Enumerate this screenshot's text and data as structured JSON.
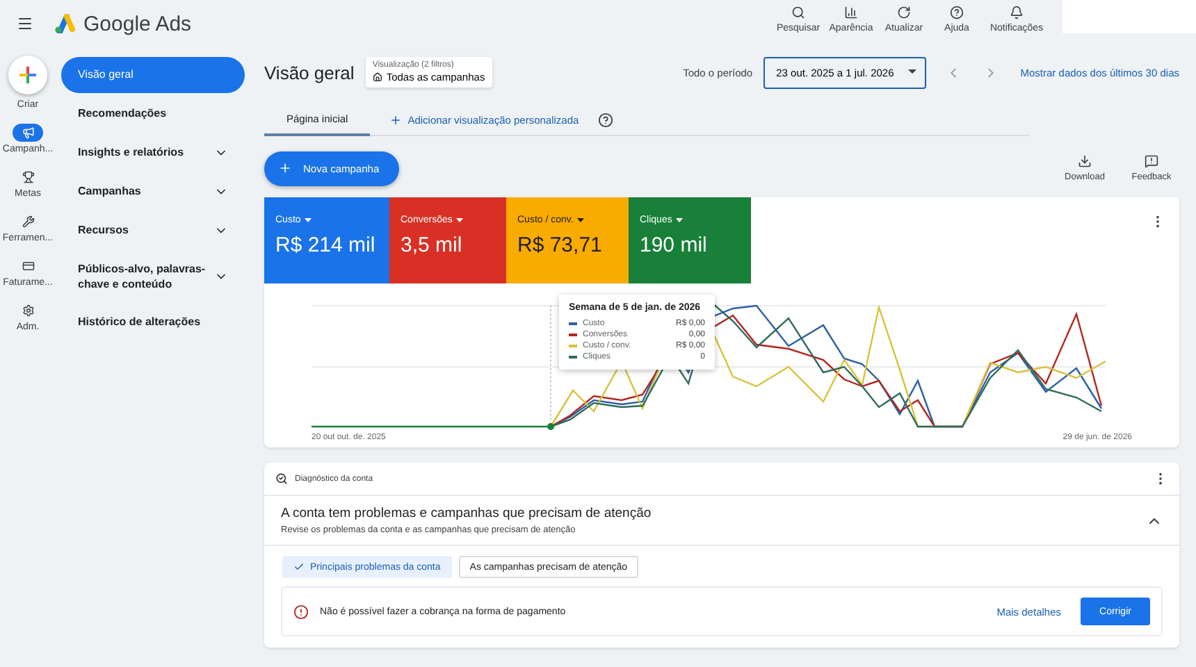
{
  "header": {
    "logo_text": "Google Ads",
    "actions": [
      {
        "kind": "search",
        "label": "Pesquisar"
      },
      {
        "kind": "appearance",
        "label": "Aparência"
      },
      {
        "kind": "refresh",
        "label": "Atualizar"
      },
      {
        "kind": "help",
        "label": "Ajuda"
      },
      {
        "kind": "notifications",
        "label": "Notificações"
      }
    ]
  },
  "rail": {
    "create_label": "Criar",
    "items": [
      {
        "kind": "campaigns",
        "label": "Campanh...",
        "selected": true
      },
      {
        "kind": "goals",
        "label": "Metas",
        "selected": false
      },
      {
        "kind": "tools",
        "label": "Ferramen...",
        "selected": false
      },
      {
        "kind": "billing",
        "label": "Faturame...",
        "selected": false
      },
      {
        "kind": "admin",
        "label": "Adm.",
        "selected": false
      }
    ]
  },
  "nav": {
    "items": [
      {
        "label": "Visão geral",
        "expandable": false,
        "selected": true
      },
      {
        "label": "Recomendações",
        "expandable": false,
        "selected": false
      },
      {
        "label": "Insights e relatórios",
        "expandable": true,
        "selected": false
      },
      {
        "label": "Campanhas",
        "expandable": true,
        "selected": false
      },
      {
        "label": "Recursos",
        "expandable": true,
        "selected": false
      },
      {
        "label": "Públicos-alvo, palavras-chave e conteúdo",
        "expandable": true,
        "selected": false
      },
      {
        "label": "Histórico de alterações",
        "expandable": false,
        "selected": false
      }
    ]
  },
  "page": {
    "title": "Visão geral",
    "view_filter": {
      "caption": "Visualização (2 filtros)",
      "value": "Todas as campanhas"
    },
    "period_label": "Todo o período",
    "date_range": "23 out. 2025 a 1 jul. 2026",
    "last30_link": "Mostrar dados dos últimos 30 dias",
    "tabs": [
      {
        "label": "Página inicial",
        "selected": true
      }
    ],
    "add_view": "Adicionar visualização personalizada",
    "new_campaign": "Nova campanha",
    "tools": [
      {
        "kind": "download",
        "label": "Download"
      },
      {
        "kind": "feedback",
        "label": "Feedback"
      }
    ],
    "metrics": [
      {
        "label": "Custo",
        "value": "R$ 214 mil",
        "color": "#1a73e8"
      },
      {
        "label": "Conversões",
        "value": "3,5 mil",
        "color": "#d93025"
      },
      {
        "label": "Custo / conv.",
        "value": "R$ 73,71",
        "color": "#f9ab00"
      },
      {
        "label": "Cliques",
        "value": "190 mil",
        "color": "#188038"
      }
    ],
    "chart": {
      "x_start": "20 out out. de. 2025",
      "x_end": "29 de jun. de 2026",
      "tooltip": {
        "title": "Semana de 5 de jan. de 2026",
        "rows": [
          {
            "label": "Custo",
            "value": "R$ 0,00",
            "color": "#2b5fa8"
          },
          {
            "label": "Conversões",
            "value": "0,00",
            "color": "#b3261e"
          },
          {
            "label": "Custo / conv.",
            "value": "R$ 0,00",
            "color": "#d8c23c"
          },
          {
            "label": "Cliques",
            "value": "0",
            "color": "#2e6b5b"
          }
        ]
      }
    },
    "diagnostics": {
      "title": "Diagnóstico da conta",
      "heading": "A conta tem problemas e campanhas que precisam de atenção",
      "subheading": "Revise os problemas da conta e as campanhas que precisam de atenção",
      "expanded": true,
      "chips": [
        {
          "label": "Principais problemas da conta",
          "selected": true
        },
        {
          "label": "As campanhas precisam de atenção",
          "selected": false
        }
      ],
      "alert": {
        "message": "Não é possível fazer a cobrança na forma de pagamento",
        "details_link": "Mais detalhes",
        "fix_button": "Corrigir"
      }
    }
  }
}
